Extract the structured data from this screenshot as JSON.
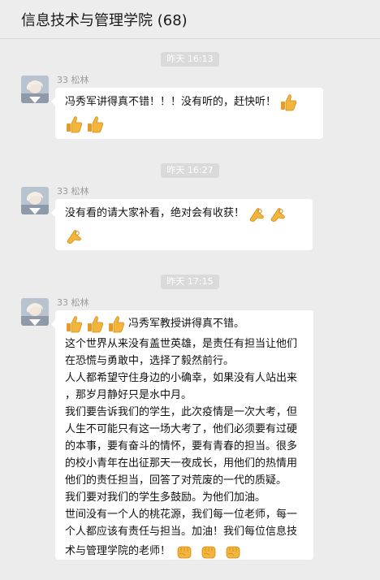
{
  "header": {
    "title": "信息技术与管理学院 (68)"
  },
  "messages": [
    {
      "time": "昨天 16:13",
      "sender": "33 松林",
      "lines": [
        "冯秀军讲得真不错！！！没有听的，赶快听！"
      ],
      "icons": [
        "thumbs-up-icon",
        "thumbs-up-icon",
        "thumbs-up-icon"
      ]
    },
    {
      "time": "昨天 16:27",
      "sender": "33 松林",
      "lines": [
        "没有看的请大家补看，绝对会有收获！"
      ],
      "icons": [
        "ok-hand-icon",
        "ok-hand-icon",
        "ok-hand-icon"
      ]
    },
    {
      "time": "昨天 17:15",
      "sender": "33 松林",
      "lines": [
        "冯秀军教授讲得真不错。",
        "这个世界从来没有盖世英雄，是责任有担当让他们",
        "在恐慌与勇敢中，选择了毅然前行。",
        "人人都希望守住身边的小确幸，如果没有人站出来",
        "，那岁月静好只是水中月。",
        "我们要告诉我们的学生，此次疫情是一次大考，但",
        "人生不可能只有这一场大考了，他们必须要有过硬",
        "的本事，要有奋斗的情怀，要有青春的担当。很多",
        "的校小青年在出征那天一夜成长，用他们的热情用",
        "他们的责任担当，回答了对荒废的一代的质疑。",
        "我们要对我们的学生多鼓励。为他们加油。",
        "世间没有一个人的桃花源，我们每一位老师，每一",
        "个人都应该有责任与担当。加油！我们每位信息技",
        "术与管理学院的老师！"
      ],
      "icons": [
        "thumbs-up-icon",
        "thumbs-up-icon",
        "thumbs-up-icon",
        "fist-icon",
        "fist-icon",
        "fist-icon"
      ]
    }
  ],
  "colors": {
    "background": "#ececec",
    "bubble": "#ffffff",
    "timestamp_bg": "#dadada",
    "emoji": "#f2b63c"
  }
}
